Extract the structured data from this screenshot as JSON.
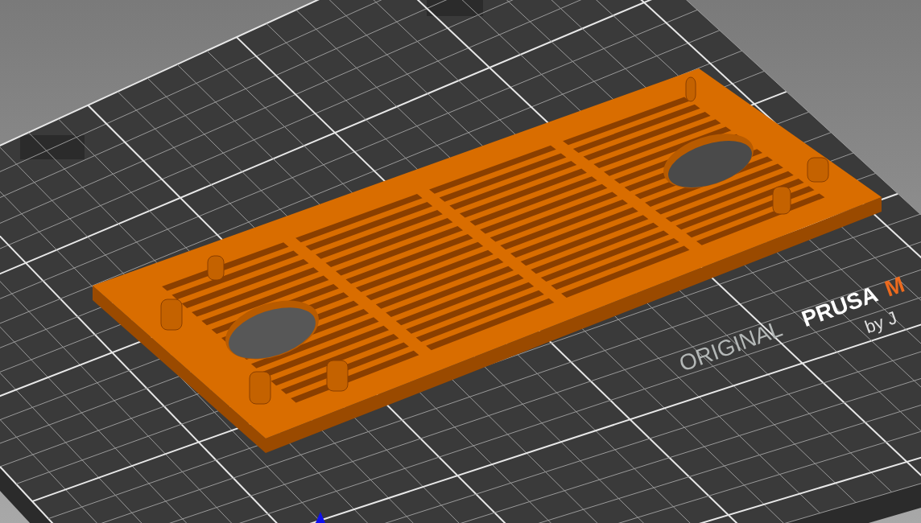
{
  "viewport": {
    "bed_logo": [
      {
        "kind": "muted",
        "text": "ORIGINAL"
      },
      {
        "kind": "strong",
        "text": "PRUSA"
      },
      {
        "kind": "accent",
        "text": "M"
      }
    ],
    "bed_byline": "by J"
  }
}
